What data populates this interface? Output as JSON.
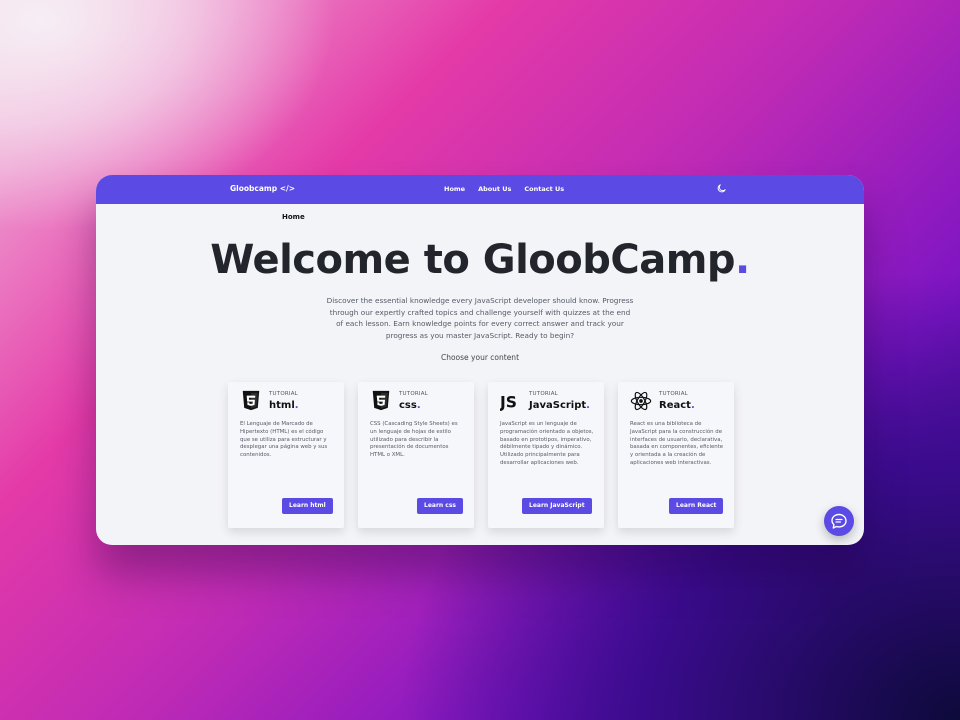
{
  "nav": {
    "brand": "Gloobcamp </>",
    "links": [
      "Home",
      "About Us",
      "Contact Us"
    ],
    "icon": "moon-icon"
  },
  "breadcrumb": "Home",
  "hero": {
    "title": "Welcome to GloobCamp",
    "title_dot": ".",
    "intro": "Discover the essential knowledge every JavaScript developer should know. Progress through our expertly crafted topics and challenge yourself with quizzes at the end of each lesson. Earn knowledge points for every correct answer and track your progress as you master JavaScript. Ready to begin?",
    "choose": "Choose your content"
  },
  "cards": [
    {
      "kind": "TUTORIAL",
      "name": "html",
      "desc": "El Lenguaje de Marcado de Hipertexto (HTML) es el código que se utiliza para estructurar y desplegar una página web y sus contenidos.",
      "button": "Learn html",
      "icon": "html5-icon"
    },
    {
      "kind": "TUTORIAL",
      "name": "css",
      "desc": "CSS (Cascading Style Sheets) es un lenguaje de hojas de estilo utilizado para describir la presentación de documentos HTML o XML.",
      "button": "Learn css",
      "icon": "css3-icon"
    },
    {
      "kind": "TUTORIAL",
      "name": "JavaScript",
      "desc": "JavaScript es un lenguaje de programación orientado a objetos, basado en prototipos, imperativo, débilmente tipado y dinámico. Utilizado principalmente para desarrollar aplicaciones web.",
      "button": "Learn JavaScript",
      "icon": "js-icon"
    },
    {
      "kind": "TUTORIAL",
      "name": "React",
      "desc": "React es una biblioteca de JavaScript para la construcción de interfaces de usuario, declarativa, basada en componentes, eficiente y orientada a la creación de aplicaciones web interactivas.",
      "button": "Learn React",
      "icon": "react-icon"
    }
  ],
  "chat": {
    "icon": "chat-icon"
  },
  "colors": {
    "accent": "#5b4ae4",
    "page": "#f3f4f8"
  }
}
